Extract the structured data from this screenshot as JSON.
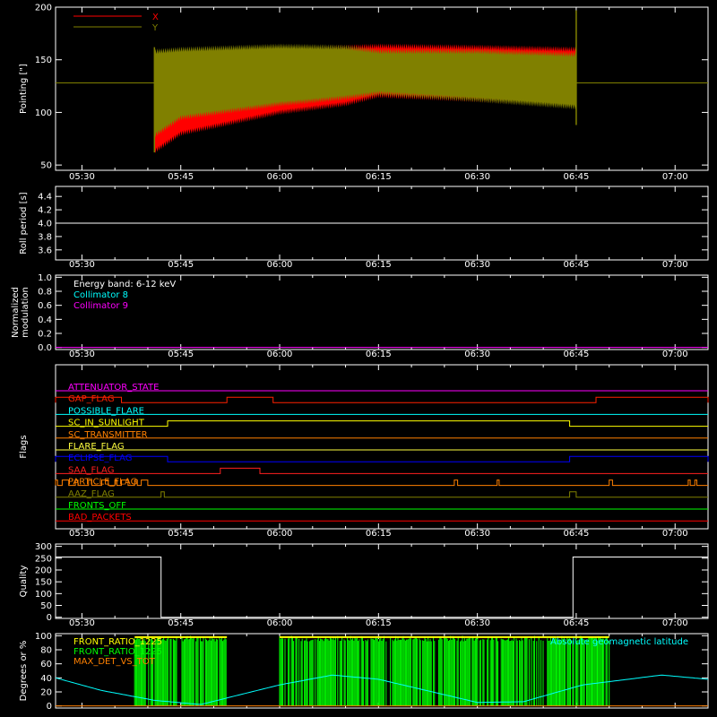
{
  "chart_data": [
    {
      "type": "line",
      "ylabel": "Pointing [\"]",
      "ylim": [
        45,
        200
      ],
      "yticks": [
        50,
        100,
        150,
        200
      ],
      "xticks": [
        "05:30",
        "05:45",
        "06:00",
        "06:15",
        "06:30",
        "06:45",
        "07:00"
      ],
      "series": [
        {
          "name": "X",
          "color": "#ff0000"
        },
        {
          "name": "Y",
          "color": "#808000"
        }
      ],
      "constant_level": 128,
      "pointing_window": [
        "05:41",
        "06:45"
      ],
      "envelope_x": {
        "x": [
          "05:41",
          "05:45",
          "06:00",
          "06:10",
          "06:15",
          "06:30",
          "06:45"
        ],
        "upper": [
          155,
          158,
          160,
          162,
          163,
          162,
          160
        ],
        "lower": [
          63,
          80,
          100,
          108,
          116,
          112,
          108
        ]
      },
      "envelope_y": {
        "x": [
          "05:41",
          "05:45",
          "06:00",
          "06:10",
          "06:15",
          "06:30",
          "06:45"
        ],
        "upper": [
          158,
          160,
          163,
          162,
          158,
          158,
          155
        ],
        "lower": [
          78,
          95,
          108,
          114,
          118,
          112,
          105
        ]
      }
    },
    {
      "type": "line",
      "ylabel": "Roll period [s]",
      "ylim": [
        3.45,
        4.55
      ],
      "yticks": [
        "3.6",
        "3.8",
        "4.0",
        "4.2",
        "4.4"
      ],
      "xticks": [
        "05:30",
        "05:45",
        "06:00",
        "06:15",
        "06:30",
        "06:45",
        "07:00"
      ],
      "series": [
        {
          "color": "#ffffff",
          "value": 4.0
        }
      ]
    },
    {
      "type": "line",
      "ylabel": [
        "Normalized",
        "modulation"
      ],
      "ylim": [
        -0.03,
        1.03
      ],
      "yticks": [
        "0.0",
        "0.2",
        "0.4",
        "0.6",
        "0.8",
        "1.0"
      ],
      "xticks": [
        "05:30",
        "05:45",
        "06:00",
        "06:15",
        "06:30",
        "06:45",
        "07:00"
      ],
      "legend": [
        "Energy band: 6-12 keV",
        "Collimator 8",
        "Collimator 9"
      ],
      "legend_colors": [
        "#ffffff",
        "#00ffff",
        "#ff00ff"
      ],
      "series": [
        {
          "color": "#ff00ff",
          "value": 0.0
        }
      ]
    },
    {
      "type": "line",
      "ylabel": "Flags",
      "xticks": [
        "05:30",
        "05:45",
        "06:00",
        "06:15",
        "06:30",
        "06:45",
        "07:00"
      ],
      "flags": [
        {
          "name": "ATTENUATOR_STATE",
          "color": "#ff00ff",
          "on": []
        },
        {
          "name": "GAP_FLAG",
          "color": "#ff2000",
          "on": [
            [
              "05:26",
              "05:36"
            ],
            [
              "05:52",
              "05:59"
            ],
            [
              "06:48",
              "07:05"
            ]
          ]
        },
        {
          "name": "POSSIBLE_FLARE",
          "color": "#00ffff",
          "on": []
        },
        {
          "name": "SC_IN_SUNLIGHT",
          "color": "#ffff00",
          "on": [
            [
              "05:43",
              "06:44"
            ]
          ]
        },
        {
          "name": "SC_TRANSMITTER",
          "color": "#ff8000",
          "on": []
        },
        {
          "name": "FLARE_FLAG",
          "color": "#ffff40",
          "on": []
        },
        {
          "name": "ECLIPSE_FLAG",
          "color": "#0000ff",
          "on": [
            [
              "05:26",
              "05:43"
            ],
            [
              "06:44",
              "07:05"
            ]
          ]
        },
        {
          "name": "SAA_FLAG",
          "color": "#ff2020",
          "on": [
            [
              "05:51",
              "05:57"
            ]
          ]
        },
        {
          "name": "PARTICLE_FLAG",
          "color": "#ff8000",
          "on": [
            [
              "05:26",
              "05:26.3"
            ],
            [
              "05:27",
              "05:28"
            ],
            [
              "05:29",
              "05:29.4"
            ],
            [
              "05:31",
              "05:31.5"
            ],
            [
              "05:33",
              "05:34"
            ],
            [
              "05:35",
              "05:35.3"
            ],
            [
              "05:36",
              "05:37"
            ],
            [
              "05:38",
              "05:38.4"
            ],
            [
              "05:39",
              "05:40"
            ],
            [
              "06:26.5",
              "06:27"
            ],
            [
              "06:33",
              "06:33.3"
            ],
            [
              "06:50",
              "06:50.5"
            ],
            [
              "07:02",
              "07:02.3"
            ],
            [
              "07:03",
              "07:03.3"
            ]
          ]
        },
        {
          "name": "AAZ_FLAG",
          "color": "#808000",
          "on": [
            [
              "05:42",
              "05:42.5"
            ],
            [
              "06:44",
              "06:45"
            ]
          ]
        },
        {
          "name": "FRONTS_OFF",
          "color": "#00ff00",
          "on": []
        },
        {
          "name": "BAD_PACKETS",
          "color": "#ff0000",
          "on": []
        }
      ]
    },
    {
      "type": "line",
      "ylabel": "Quality",
      "ylim": [
        -5,
        310
      ],
      "yticks": [
        0,
        50,
        100,
        150,
        200,
        250,
        300
      ],
      "xticks": [
        "05:30",
        "05:45",
        "06:00",
        "06:15",
        "06:30",
        "06:45",
        "07:00"
      ],
      "series": [
        {
          "color": "#ffffff",
          "x": [
            "05:26",
            "05:42",
            "05:42",
            "06:44.5",
            "06:44.5",
            "07:05"
          ],
          "y": [
            255,
            255,
            0,
            0,
            255,
            255
          ]
        }
      ]
    },
    {
      "type": "area",
      "ylabel": "Degrees or %",
      "ylim": [
        -3,
        103
      ],
      "yticks": [
        0,
        20,
        40,
        60,
        80,
        100
      ],
      "xticks": [
        "05:30",
        "05:45",
        "06:00",
        "06:15",
        "06:30",
        "06:45",
        "07:00"
      ],
      "legend": [
        "FRONT_RATIO_1225",
        "FRONT_RATIO_1225",
        "MAX_DET_VS_TOT"
      ],
      "legend_colors": [
        "#ffff00",
        "#00ff00",
        "#ff8000"
      ],
      "annotation": "Absolute geomagnetic latitude",
      "annotation_color": "#00ffff",
      "ratio_blocks": [
        [
          "05:38",
          "05:52"
        ],
        [
          "06:00",
          "06:42"
        ],
        [
          "06:42",
          "06:50"
        ]
      ],
      "latitude": {
        "x": [
          "05:26",
          "05:33",
          "05:41",
          "05:48",
          "06:00",
          "06:08",
          "06:15",
          "06:30",
          "06:37",
          "06:46",
          "06:58",
          "07:05"
        ],
        "y": [
          40,
          22,
          8,
          2,
          30,
          44,
          38,
          5,
          6,
          30,
          44,
          38
        ]
      }
    }
  ]
}
